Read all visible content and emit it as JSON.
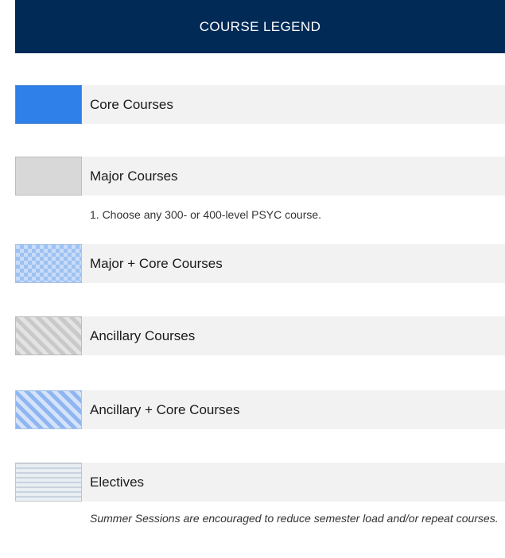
{
  "header": {
    "title": "COURSE LEGEND"
  },
  "legend": [
    {
      "label": "Core Courses",
      "swatch": "solid-blue"
    },
    {
      "label": "Major Courses",
      "swatch": "solid-gray",
      "note": "1. Choose any 300- or 400-level PSYC course."
    },
    {
      "label": "Major + Core Courses",
      "swatch": "blue-checker"
    },
    {
      "label": "Ancillary Courses",
      "swatch": "gray-diagonal-stripes"
    },
    {
      "label": "Ancillary + Core Courses",
      "swatch": "blue-diagonal-stripes"
    },
    {
      "label": "Electives",
      "swatch": "light-horizontal-stripes",
      "note": "Summer Sessions are encouraged to reduce semester load and/or repeat courses."
    }
  ],
  "colors": {
    "header_bg": "#012a57",
    "core": "#2f80e8",
    "major": "#d8d8d8",
    "label_bg": "#f2f2f2"
  }
}
